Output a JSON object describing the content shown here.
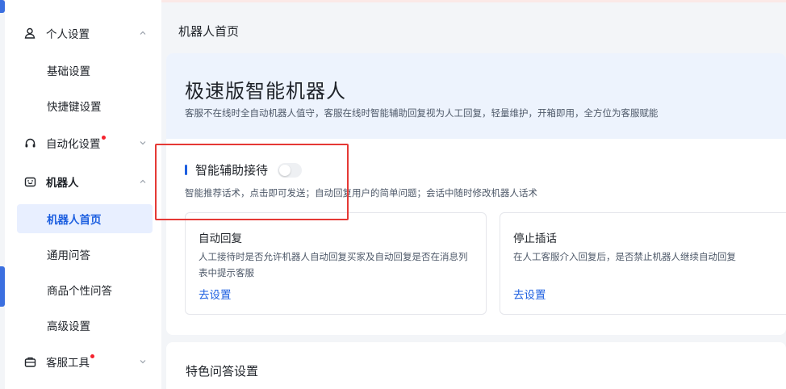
{
  "sidebar": {
    "groups": [
      {
        "label": "个人设置",
        "icon": "user-icon"
      },
      {
        "label": "自动化设置",
        "icon": "headset-icon",
        "badge": true
      },
      {
        "label": "机器人",
        "icon": "robot-icon"
      },
      {
        "label": "客服工具",
        "icon": "toolbox-icon",
        "badge": true
      }
    ],
    "personal_items": [
      {
        "label": "基础设置"
      },
      {
        "label": "快捷键设置"
      }
    ],
    "robot_items": [
      {
        "label": "机器人首页",
        "active": true
      },
      {
        "label": "通用问答"
      },
      {
        "label": "商品个性问答"
      },
      {
        "label": "高级设置"
      }
    ]
  },
  "breadcrumb": "机器人首页",
  "hero": {
    "title": "极速版智能机器人",
    "desc": "客服不在线时全自动机器人值守，客服在线时智能辅助回复视为人工回复，轻量维护，开箱即用，全方位为客服赋能"
  },
  "assist": {
    "title": "智能辅助接待",
    "enabled": false,
    "desc": "智能推荐话术，点击即可发送；自动回复用户的简单问题；会话中随时修改机器人话术"
  },
  "options": [
    {
      "title": "自动回复",
      "desc": "人工接待时是否允许机器人自动回复买家及自动回复是否在消息列表中提示客服",
      "link": "去设置"
    },
    {
      "title": "停止插话",
      "desc": "在人工客服介入回复后，是否禁止机器人继续自动回复",
      "link": "去设置"
    }
  ],
  "featured": {
    "title": "特色问答设置"
  },
  "colors": {
    "accent": "#1d5fe0",
    "highlight": "#e53935",
    "badge": "#f5222d"
  }
}
